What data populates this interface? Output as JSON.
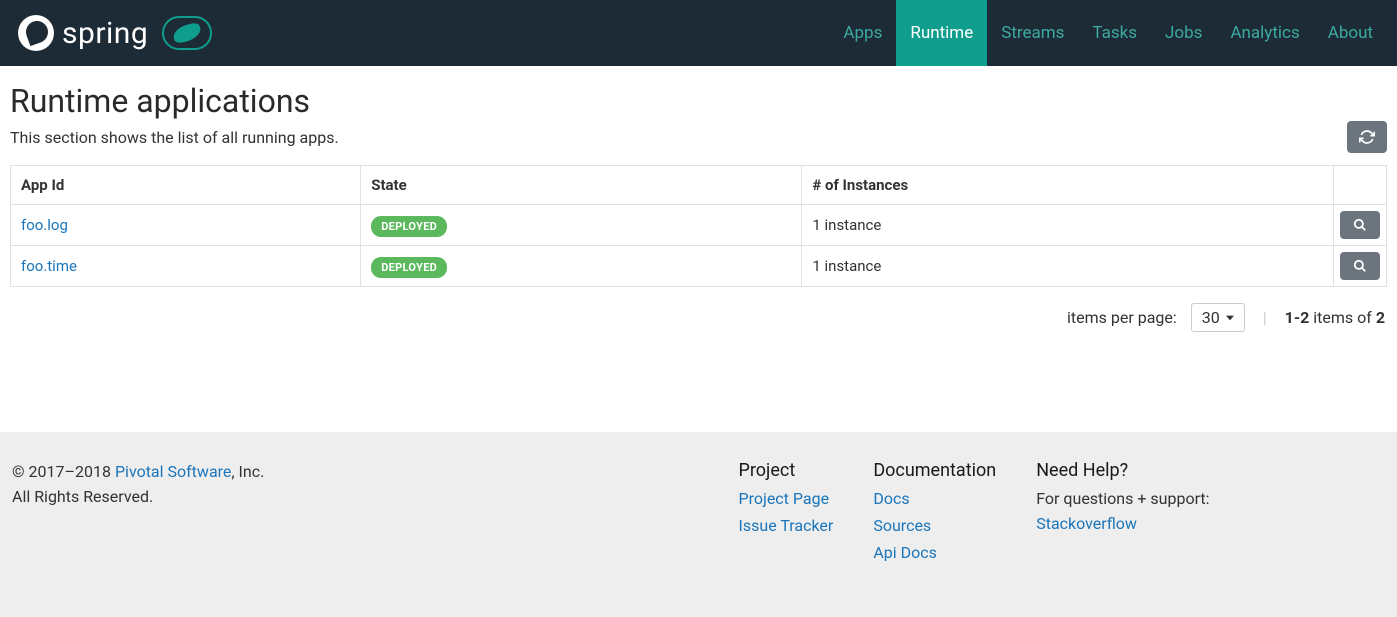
{
  "brand": "spring",
  "nav": {
    "items": [
      {
        "label": "Apps",
        "active": false
      },
      {
        "label": "Runtime",
        "active": true
      },
      {
        "label": "Streams",
        "active": false
      },
      {
        "label": "Tasks",
        "active": false
      },
      {
        "label": "Jobs",
        "active": false
      },
      {
        "label": "Analytics",
        "active": false
      },
      {
        "label": "About",
        "active": false
      }
    ]
  },
  "page": {
    "title": "Runtime applications",
    "subtitle": "This section shows the list of all running apps."
  },
  "table": {
    "headers": {
      "id": "App Id",
      "state": "State",
      "instances": "# of Instances"
    },
    "rows": [
      {
        "id": "foo.log",
        "state": "DEPLOYED",
        "instances": "1 instance"
      },
      {
        "id": "foo.time",
        "state": "DEPLOYED",
        "instances": "1 instance"
      }
    ]
  },
  "pager": {
    "items_label": "items per page:",
    "per_page": "30",
    "range": "1-2",
    "items_word": " items of ",
    "total": "2"
  },
  "footer": {
    "copyright_prefix": "© 2017–2018 ",
    "company": "Pivotal Software",
    "company_suffix": ", Inc.",
    "rights": "All Rights Reserved.",
    "project": {
      "heading": "Project",
      "links": [
        "Project Page",
        "Issue Tracker"
      ]
    },
    "docs": {
      "heading": "Documentation",
      "links": [
        "Docs",
        "Sources",
        "Api Docs"
      ]
    },
    "help": {
      "heading": "Need Help?",
      "text": "For questions + support:",
      "link": "Stackoverflow"
    }
  }
}
